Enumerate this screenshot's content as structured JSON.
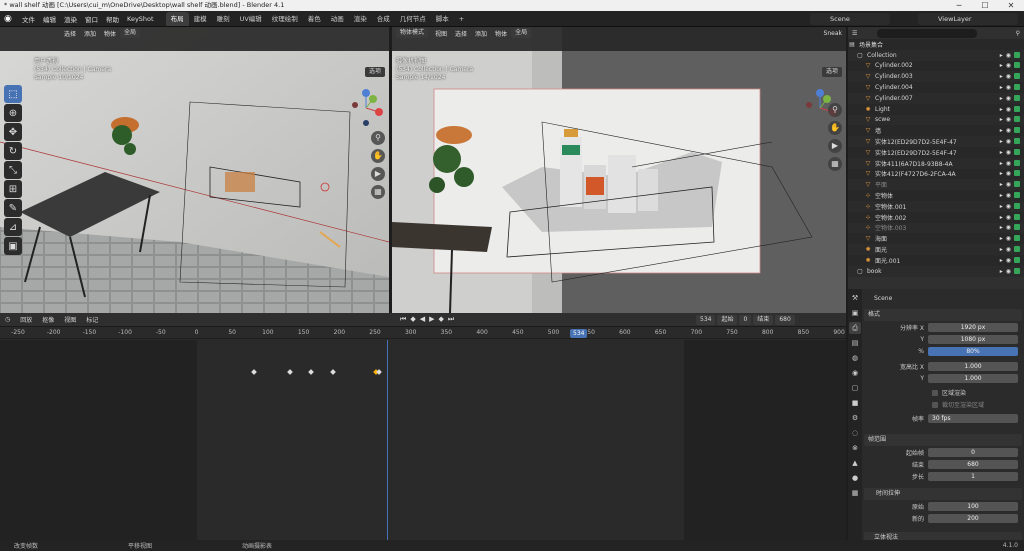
{
  "window": {
    "title": "* wall shelf 动画 [C:\\Users\\cui_m\\OneDrive\\Desktop\\wall shelf 动画.blend] - Blender 4.1"
  },
  "menubar": {
    "items": [
      "文件",
      "编辑",
      "渲染",
      "窗口",
      "帮助",
      "KeyShot"
    ],
    "workspaces": [
      "布局",
      "建模",
      "雕刻",
      "UV编辑",
      "纹理绘制",
      "着色",
      "动画",
      "渲染",
      "合成",
      "几何节点",
      "脚本"
    ],
    "active_workspace": "布局",
    "scene": "Scene",
    "view_layer": "ViewLayer"
  },
  "viewport_left": {
    "menu": [
      "选择",
      "添加",
      "物体"
    ],
    "orientation": "全局",
    "view_name": "用户透视",
    "collection": "(534) Collection | Camera",
    "sample": "Sample 10/1024",
    "options": "选项"
  },
  "viewport_right": {
    "mode": "物体模式",
    "menu": [
      "视图",
      "选择",
      "添加",
      "物体"
    ],
    "orientation": "全局",
    "view_name": "摄像机视图",
    "collection": "(534) Collection | Camera",
    "sample": "Sample 14/1024",
    "options": "选项",
    "sneak": "Sneak"
  },
  "timeline": {
    "menu": [
      "回放",
      "抠像",
      "视图",
      "标记"
    ],
    "current_frame": "534",
    "start_label": "起始",
    "start_value": "0",
    "end_label": "结束",
    "end_value": "680",
    "ticks": [
      "-250",
      "-200",
      "-150",
      "-100",
      "-50",
      "0",
      "50",
      "100",
      "150",
      "200",
      "250",
      "300",
      "350",
      "400",
      "450",
      "500",
      "550",
      "600",
      "650",
      "700",
      "750",
      "800",
      "850",
      "900"
    ],
    "keyframes": [
      80,
      130,
      160,
      190,
      250,
      255
    ],
    "selected_keyframes": [
      250
    ]
  },
  "outliner": {
    "root": "场景集合",
    "items": [
      {
        "name": "Collection",
        "icon": "collection-icon",
        "dim": false
      },
      {
        "name": "Cylinder.002",
        "icon": "mesh-icon",
        "dim": false
      },
      {
        "name": "Cylinder.003",
        "icon": "mesh-icon",
        "dim": false
      },
      {
        "name": "Cylinder.004",
        "icon": "mesh-icon",
        "dim": false
      },
      {
        "name": "Cylinder.007",
        "icon": "mesh-icon",
        "dim": false
      },
      {
        "name": "Light",
        "icon": "light-icon",
        "dim": false
      },
      {
        "name": "scwe",
        "icon": "mesh-icon",
        "dim": false
      },
      {
        "name": "墙",
        "icon": "mesh-icon",
        "dim": false
      },
      {
        "name": "实体12(ED29D7D2-5E4F-47",
        "icon": "mesh-icon",
        "dim": false
      },
      {
        "name": "实体12(ED29D7D2-5E4F-47",
        "icon": "mesh-icon",
        "dim": false
      },
      {
        "name": "实体411(6A7D18-93B8-4A",
        "icon": "mesh-icon",
        "dim": false
      },
      {
        "name": "实体412(F4727D6-2FCA-4A",
        "icon": "mesh-icon",
        "dim": false
      },
      {
        "name": "平面",
        "icon": "mesh-icon",
        "dim": true
      },
      {
        "name": "空物体",
        "icon": "empty-icon",
        "dim": false
      },
      {
        "name": "空物体.001",
        "icon": "empty-icon",
        "dim": false
      },
      {
        "name": "空物体.002",
        "icon": "empty-icon",
        "dim": false
      },
      {
        "name": "空物体.003",
        "icon": "empty-icon",
        "dim": true
      },
      {
        "name": "海面",
        "icon": "mesh-icon",
        "dim": false
      },
      {
        "name": "面光",
        "icon": "light-icon",
        "dim": false
      },
      {
        "name": "面光.001",
        "icon": "light-icon",
        "dim": false
      },
      {
        "name": "book",
        "icon": "collection-icon",
        "dim": false
      }
    ]
  },
  "properties": {
    "scene": "Scene",
    "format_panel": "格式",
    "res_x_label": "分辨率 X",
    "res_x": "1920 px",
    "res_y_label": "Y",
    "res_y": "1080 px",
    "pct_label": "%",
    "pct": "80%",
    "aspect_x_label": "宽高比 X",
    "aspect_x": "1.000",
    "aspect_y_label": "Y",
    "aspect_y": "1.000",
    "region_render": "区域渲染",
    "crop_render": "裁切至渲染区域",
    "fps_label": "帧率",
    "fps": "30 fps",
    "frame_range_panel": "帧范围",
    "frame_start_label": "起始帧",
    "frame_start": "0",
    "frame_end_label": "结束",
    "frame_end": "680",
    "frame_step_label": "步长",
    "frame_step": "1",
    "time_stretch_panel": "时间拉伸",
    "old_label": "原始",
    "old_value": "100",
    "new_label": "新的",
    "new_value": "200",
    "stereo_panel": "立体视法"
  },
  "statusbar": {
    "items": [
      "改变帧数",
      "平移视图",
      "动画摄影表"
    ],
    "version": "4.1.0"
  }
}
